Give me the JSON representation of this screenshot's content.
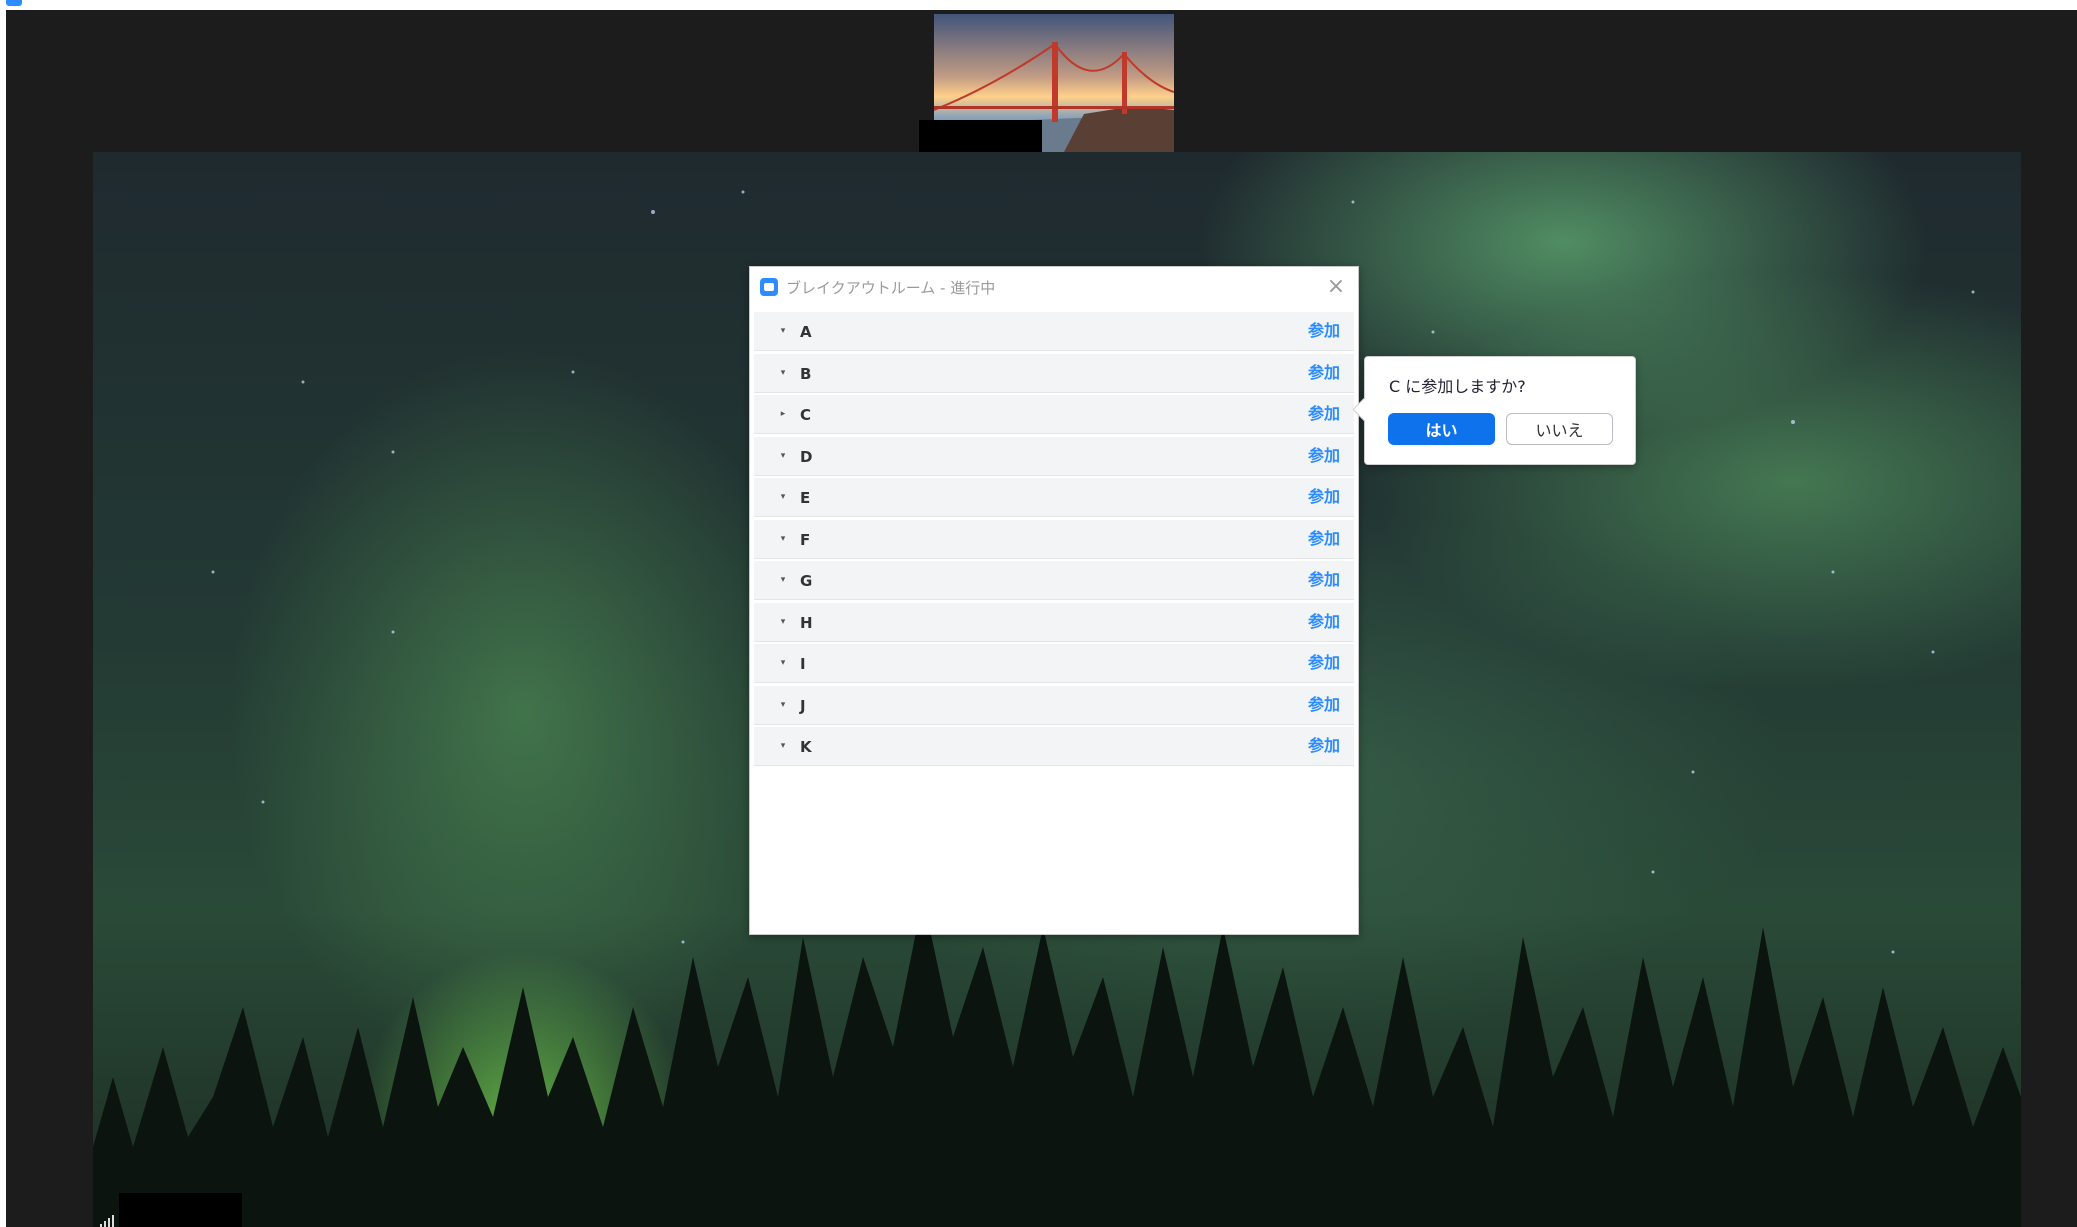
{
  "dialog": {
    "title": "ブレイクアウトルーム - 進行中",
    "close_icon": "close-icon",
    "rooms": [
      {
        "name": "A",
        "join": "参加",
        "toggle": "▾"
      },
      {
        "name": "B",
        "join": "参加",
        "toggle": "▾"
      },
      {
        "name": "C",
        "join": "参加",
        "toggle": "▸"
      },
      {
        "name": "D",
        "join": "参加",
        "toggle": "▾"
      },
      {
        "name": "E",
        "join": "参加",
        "toggle": "▾"
      },
      {
        "name": "F",
        "join": "参加",
        "toggle": "▾"
      },
      {
        "name": "G",
        "join": "参加",
        "toggle": "▾"
      },
      {
        "name": "H",
        "join": "参加",
        "toggle": "▾"
      },
      {
        "name": "I",
        "join": "参加",
        "toggle": "▾"
      },
      {
        "name": "J",
        "join": "参加",
        "toggle": "▾"
      },
      {
        "name": "K",
        "join": "参加",
        "toggle": "▾"
      }
    ]
  },
  "confirm": {
    "question": "C に参加しますか?",
    "yes_label": "はい",
    "no_label": "いいえ"
  },
  "colors": {
    "accent": "#2d8cff",
    "primary_button": "#0e72ed",
    "window_background": "#1c1c1c"
  }
}
